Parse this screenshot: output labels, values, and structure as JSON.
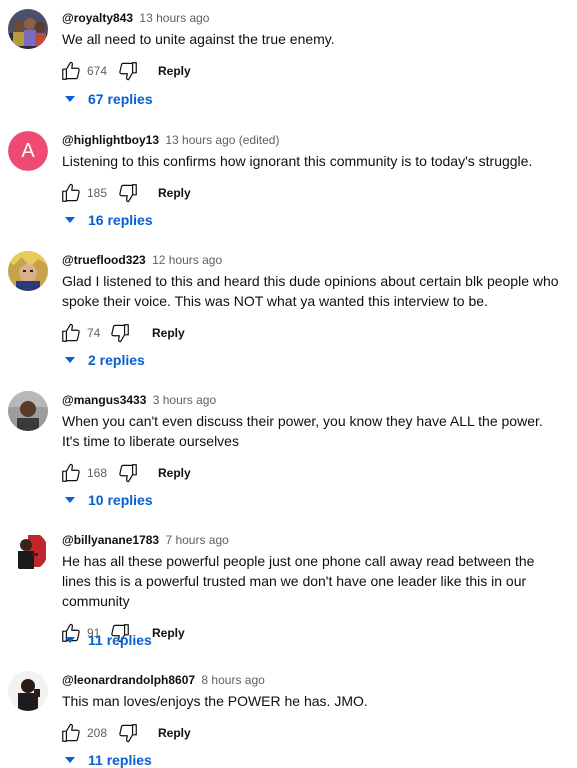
{
  "comments": [
    {
      "author": "@royalty843",
      "time": "13 hours ago",
      "text": "We all need to unite against the true enemy.",
      "likes": "674",
      "reply_label": "Reply",
      "replies": "67 replies",
      "avatar": "group-photo"
    },
    {
      "author": "@highlightboy13",
      "time": "13 hours ago (edited)",
      "text": "Listening to this confirms how ignorant this community is to today's struggle.",
      "likes": "185",
      "reply_label": "Reply",
      "replies": "16 replies",
      "avatar_letter": "A",
      "avatar_color": "#ef4b72"
    },
    {
      "author": "@trueflood323",
      "time": "12 hours ago",
      "text": "Glad I listened to this and heard this dude opinions about certain blk people who spoke their voice. This was NOT what ya wanted this interview to be.",
      "likes": "74",
      "reply_label": "Reply",
      "replies": "2 replies",
      "avatar": "character-art"
    },
    {
      "author": "@mangus3433",
      "time": "3 hours ago",
      "text": "When you can't even discuss their power, you know they have ALL the power. It's time to liberate ourselves",
      "likes": "168",
      "reply_label": "Reply",
      "replies": "10 replies",
      "avatar": "person-photo"
    },
    {
      "author": "@billyanane1783",
      "time": "7 hours ago",
      "text": "He has all these powerful people just one phone call away read between the lines this is a powerful trusted man we don't have one leader like this in our community",
      "likes": "91",
      "reply_label": "Reply",
      "replies": "11 replies",
      "avatar": "person-red-background"
    },
    {
      "author": "@leonardrandolph8607",
      "time": "8 hours ago",
      "text": "This man loves/enjoys the POWER he has.  JMO.",
      "likes": "208",
      "reply_label": "Reply",
      "replies": "11 replies",
      "avatar": "person-white-background"
    }
  ],
  "colors": {
    "link_blue": "#065fd4",
    "meta_gray": "#606060",
    "text": "#0f0f0f"
  },
  "icons": [
    "thumb-up-icon",
    "thumb-down-icon",
    "caret-down-icon"
  ]
}
